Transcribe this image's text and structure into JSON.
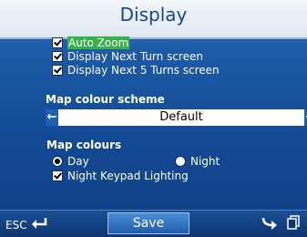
{
  "header": {
    "title": "Display"
  },
  "options": [
    {
      "label": "Auto Zoom",
      "checked": true,
      "highlighted": true
    },
    {
      "label": "Display Next Turn screen",
      "checked": true,
      "highlighted": false
    },
    {
      "label": "Display Next 5 Turns screen",
      "checked": true,
      "highlighted": false
    }
  ],
  "map_colour_scheme": {
    "heading": "Map colour scheme",
    "value": "Default"
  },
  "map_colours": {
    "heading": "Map colours",
    "day_label": "Day",
    "night_label": "Night",
    "selected": "Day",
    "keypad_label": "Night Keypad Lighting",
    "keypad_checked": true
  },
  "bottom_bar": {
    "esc_label": "ESC",
    "save_label": "Save"
  },
  "colors": {
    "highlight": "#38b14a",
    "background": "#1c5aa6",
    "title_text": "#17478a"
  }
}
